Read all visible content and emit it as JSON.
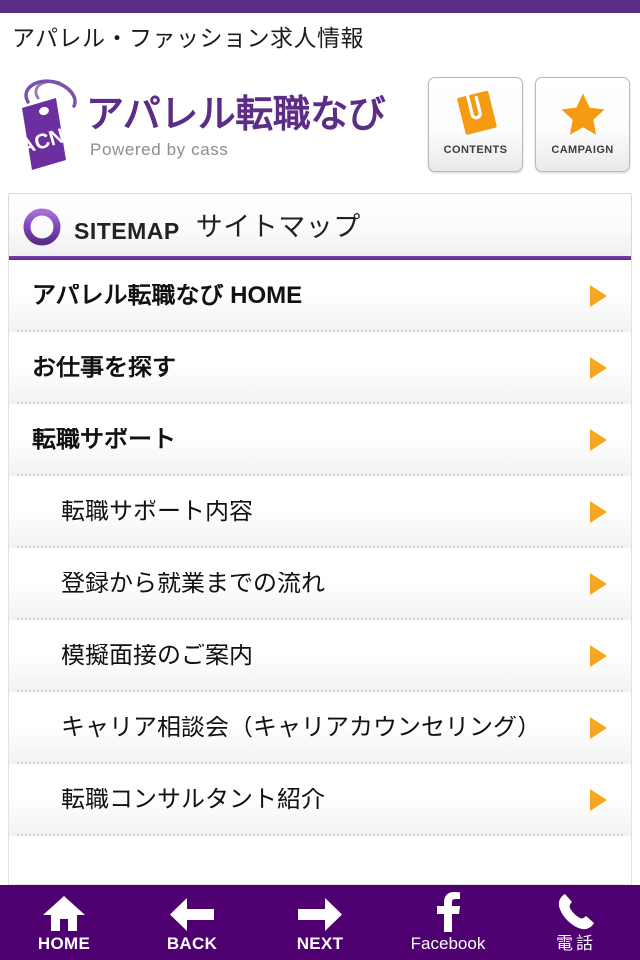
{
  "top_strip": {
    "color": "#5b2d86"
  },
  "tagline": "アパレル・ファッション求人情報",
  "brand": {
    "tag_text": "ACN",
    "title": "アパレル転職なび",
    "subtitle": "Powered by cass",
    "color": "#5b2d86"
  },
  "header_buttons": [
    {
      "label": "Contents",
      "icon": "notebook-icon"
    },
    {
      "label": "Campaign",
      "icon": "star-icon"
    }
  ],
  "sitemap_header": {
    "icon": "ring-icon",
    "title_en": "Sitemap",
    "title_ja": "サイトマップ",
    "underline_color": "#5b2d86"
  },
  "list": {
    "arrow_color": "#f5a623",
    "items": [
      {
        "label": "アパレル転職なび HOME",
        "level": 1
      },
      {
        "label": "お仕事を探す",
        "level": 1
      },
      {
        "label": "転職サポート",
        "level": 1
      },
      {
        "label": "転職サポート内容",
        "level": 2
      },
      {
        "label": "登録から就業までの流れ",
        "level": 2
      },
      {
        "label": "模擬面接のご案内",
        "level": 2
      },
      {
        "label": "キャリア相談会（キャリアカウンセリング）",
        "level": 2
      },
      {
        "label": "転職コンサルタント紹介",
        "level": 2
      }
    ]
  },
  "bottom_nav": {
    "background": "#4e0070",
    "items": [
      {
        "label": "HOME",
        "icon": "home-icon"
      },
      {
        "label": "BACK",
        "icon": "arrow-left-icon"
      },
      {
        "label": "NEXT",
        "icon": "arrow-right-icon"
      },
      {
        "label": "Facebook",
        "icon": "facebook-icon"
      },
      {
        "label": "電話",
        "icon": "phone-icon"
      }
    ]
  }
}
